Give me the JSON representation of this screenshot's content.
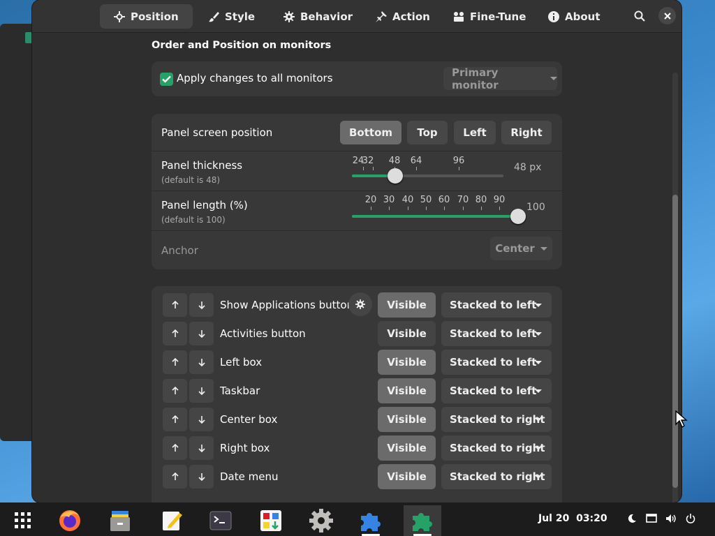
{
  "header": {
    "tabs": [
      {
        "label": "Position",
        "icon": "crosshair-icon",
        "active": true
      },
      {
        "label": "Style",
        "icon": "paint-brush-icon",
        "active": false
      },
      {
        "label": "Behavior",
        "icon": "gear-icon",
        "active": false
      },
      {
        "label": "Action",
        "icon": "pin-icon",
        "active": false
      },
      {
        "label": "Fine-Tune",
        "icon": "tools-icon",
        "active": false
      },
      {
        "label": "About",
        "icon": "info-icon",
        "active": false
      }
    ]
  },
  "section": {
    "title": "Order and Position on monitors"
  },
  "apply": {
    "label": "Apply changes to all monitors",
    "checked": true,
    "monitor": "Primary monitor"
  },
  "position": {
    "label": "Panel screen position",
    "options": [
      "Bottom",
      "Top",
      "Left",
      "Right"
    ],
    "selected": "Bottom"
  },
  "thickness": {
    "label": "Panel thickness",
    "default": "(default is 48)",
    "marks": [
      "24",
      "32",
      "48",
      "64",
      "96"
    ],
    "value": "48 px",
    "numeric": 48
  },
  "length": {
    "label": "Panel length (%)",
    "default": "(default is 100)",
    "marks": [
      "20",
      "30",
      "40",
      "50",
      "60",
      "70",
      "80",
      "90"
    ],
    "value": "100",
    "numeric": 100
  },
  "anchor": {
    "label": "Anchor",
    "value": "Center"
  },
  "elements": [
    {
      "label": "Show Applications button",
      "visible": "Visible",
      "stack": "Stacked to left",
      "gear": true
    },
    {
      "label": "Activities button",
      "visible": "Visible",
      "stack": "Stacked to left"
    },
    {
      "label": "Left box",
      "visible": "Visible",
      "stack": "Stacked to left"
    },
    {
      "label": "Taskbar",
      "visible": "Visible",
      "stack": "Stacked to left"
    },
    {
      "label": "Center box",
      "visible": "Visible",
      "stack": "Stacked to right"
    },
    {
      "label": "Right box",
      "visible": "Visible",
      "stack": "Stacked to right"
    },
    {
      "label": "Date menu",
      "visible": "Visible",
      "stack": "Stacked to right"
    }
  ],
  "taskbar": {
    "apps": [
      "app-grid-icon",
      "firefox-icon",
      "files-icon",
      "text-editor-icon",
      "terminal-icon",
      "software-icon",
      "settings-icon",
      "extensions-icon",
      "extension-manager-icon"
    ],
    "clock": "Jul 20  03:20"
  },
  "colors": {
    "accent": "#26a269",
    "window": "#2e2e2e",
    "card": "#383838",
    "taskbar": "#1c1c1c"
  }
}
